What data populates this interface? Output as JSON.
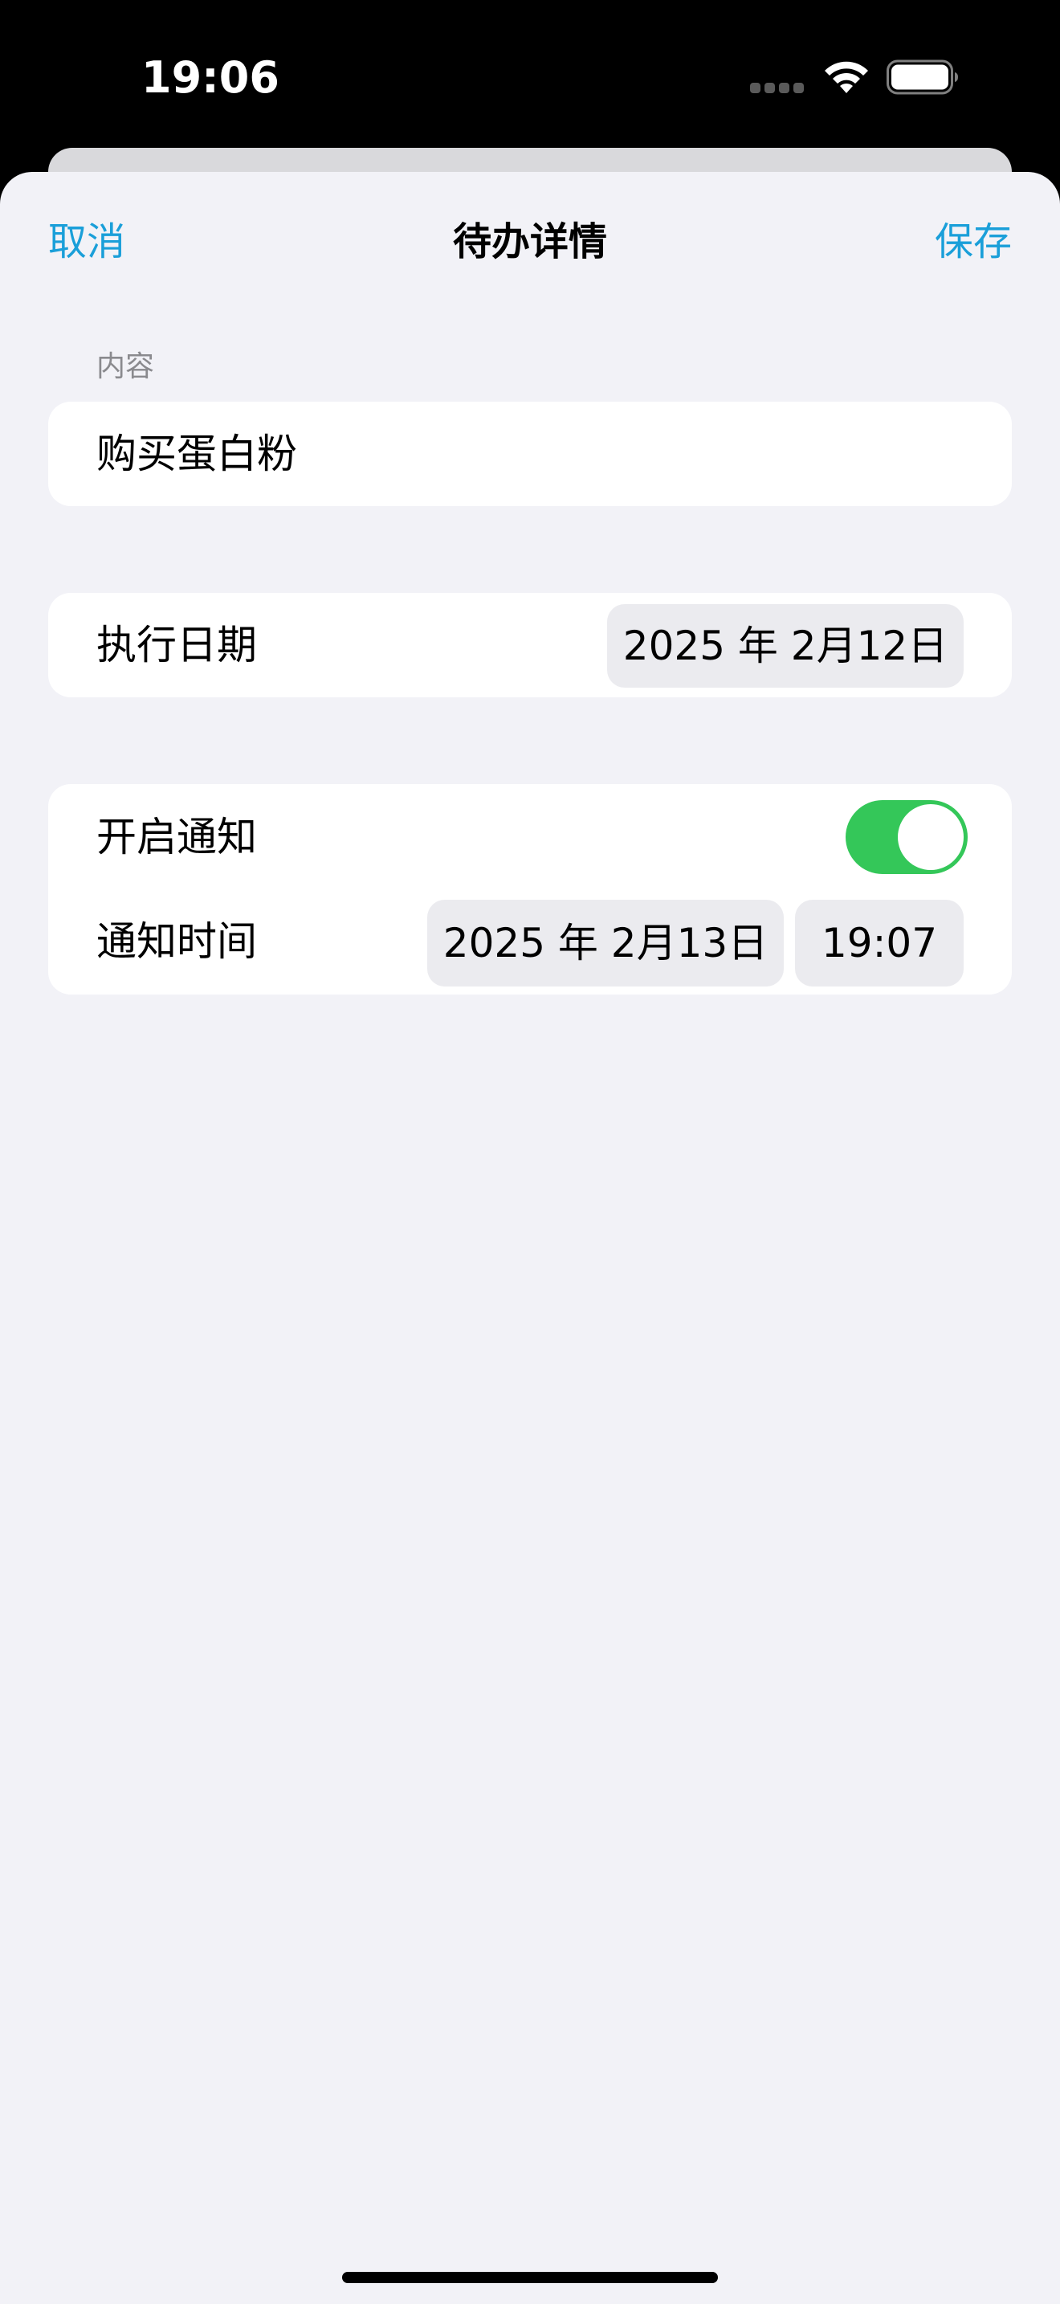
{
  "status_bar": {
    "time": "19:06",
    "signal_icon": "cellular-signal-icon",
    "wifi_icon": "wifi-icon",
    "battery_icon": "battery-icon",
    "battery_level": 1.0
  },
  "nav": {
    "cancel_label": "取消",
    "title": "待办详情",
    "save_label": "保存"
  },
  "content_section": {
    "header": "内容",
    "value": "购买蛋白粉"
  },
  "date_section": {
    "label": "执行日期",
    "value": "2025 年 2月12日"
  },
  "notify_section": {
    "toggle_label": "开启通知",
    "toggle_on": true,
    "time_label": "通知时间",
    "date_value": "2025 年 2月13日",
    "time_value": "19:07"
  },
  "colors": {
    "accent": "#1a9fd9",
    "toggle_on": "#34c759",
    "background": "#f2f2f7"
  }
}
